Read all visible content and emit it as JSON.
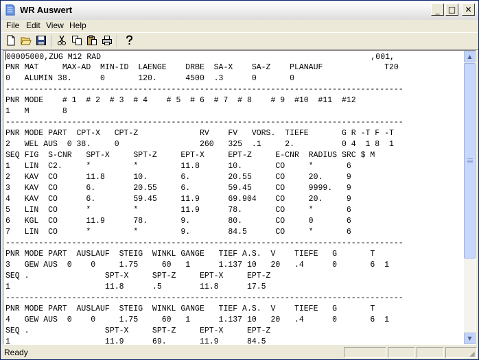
{
  "window": {
    "title": "WR Auswert",
    "controls": {
      "minimize": "_",
      "maximize": "□",
      "close": "✕"
    }
  },
  "menu": [
    "File",
    "Edit",
    "View",
    "Help"
  ],
  "toolbar": [
    "new-file-icon",
    "open-folder-icon",
    "save-disk-icon",
    "cut-scissors-icon",
    "copy-icon",
    "paste-icon",
    "print-icon",
    "help-question-icon"
  ],
  "document": {
    "lines": [
      "00005000,ZUG M12 RAD                                                         ,001,",
      "PNR MAT     MAX-AD  MIN-ID  LAENGE    DRBE  SA-X    SA-Z    PLANAUF             T20",
      "0   ALUMIN 38.      0       120.      4500  .3      0       0",
      "------------------------------------------------------------------------------------",
      "PNR MODE    # 1  # 2  # 3  # 4    # 5  # 6  # 7  # 8    # 9  #10  #11  #12",
      "1   M       8",
      "------------------------------------------------------------------------------------",
      "PNR MODE PART  CPT-X   CPT-Z             RV    FV   VORS.  TIEFE       G R -T F -T",
      "2   WEL AUS  0 38.     0                 260   325  .1     2.          0 4  1 8  1",
      "SEQ FIG  S-CNR   SPT-X     SPT-Z     EPT-X     EPT-Z     E-CNR  RADIUS SRC $ M",
      "1   LIN  C2.     *         *         11.8      10.       CO     *       6",
      "2   KAV  CO      11.8      10.       6.        20.55     CO     20.     9",
      "3   KAV  CO      6.        20.55     6.        59.45     CO     9999.   9",
      "4   KAV  CO      6.        59.45     11.9      69.904    CO     20.     9",
      "5   LIN  CO      *         *         11.9      78.       CO     *       6",
      "6   KGL  CO      11.9      78.       9.        80.       CO     0       6",
      "7   LIN  CO      *         *         9.        84.5      CO     *       6",
      "------------------------------------------------------------------------------------",
      "PNR MODE PART  AUSLAUF  STEIG  WINKL GANGE   TIEF A.S.  V    TIEFE   G       T",
      "3   GEW AUS  0    0     1.75     60   1      1.137 10   20   .4      0       6  1",
      "SEQ .                SPT-X     SPT-Z     EPT-X     EPT-Z",
      "1                    11.8      .5        11.8      17.5",
      "------------------------------------------------------------------------------------",
      "PNR MODE PART  AUSLAUF  STEIG  WINKL GANGE   TIEF A.S.  V    TIEFE   G       T",
      "4   GEW AUS  0    0     1.75     60   1      1.137 10   20   .4      0       6  1",
      "SEQ .                SPT-X     SPT-Z     EPT-X     EPT-Z",
      "1                    11.9      69.       11.9      84.5"
    ]
  },
  "status": {
    "text": "Ready"
  }
}
